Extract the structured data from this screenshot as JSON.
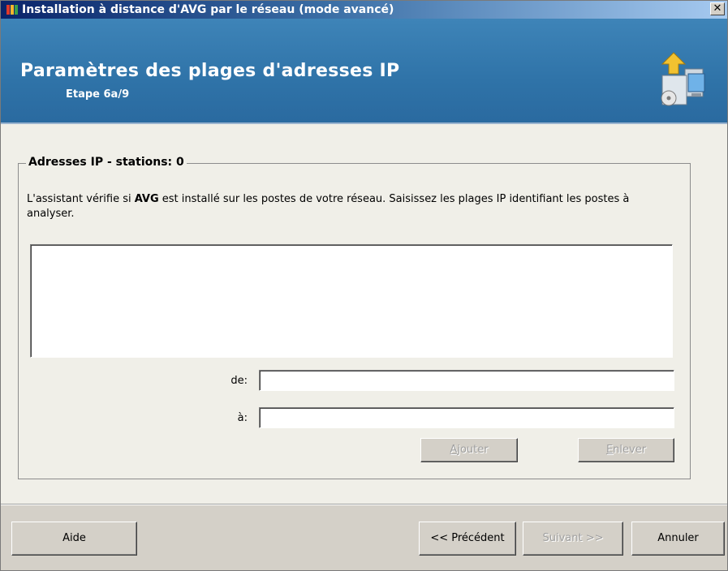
{
  "window": {
    "title": "Installation à distance d'AVG par le réseau (mode avancé)",
    "close_symbol": "✕"
  },
  "header": {
    "title": "Paramètres des plages d'adresses IP",
    "step": "Etape 6a/9",
    "icon": "computer-install-icon"
  },
  "group": {
    "legend": "Adresses IP - stations: 0",
    "description_before": "L'assistant vérifie si ",
    "description_bold": "AVG",
    "description_after": " est installé sur les postes de votre réseau. Saisissez les plages IP identifiant les postes à analyser."
  },
  "range": {
    "from_label": "de:",
    "to_label": "à:",
    "from_value": "",
    "to_value": "",
    "add_prefix": "A",
    "add_rest": "jouter",
    "remove_prefix": "E",
    "remove_rest": "nlever"
  },
  "footer": {
    "help": "Aide",
    "previous": "<< Précédent",
    "next": "Suivant >>",
    "cancel": "Annuler"
  },
  "colors": {
    "banner": "#2f73a8",
    "title_bar_start": "#0a246a",
    "face": "#d4d0c8"
  }
}
